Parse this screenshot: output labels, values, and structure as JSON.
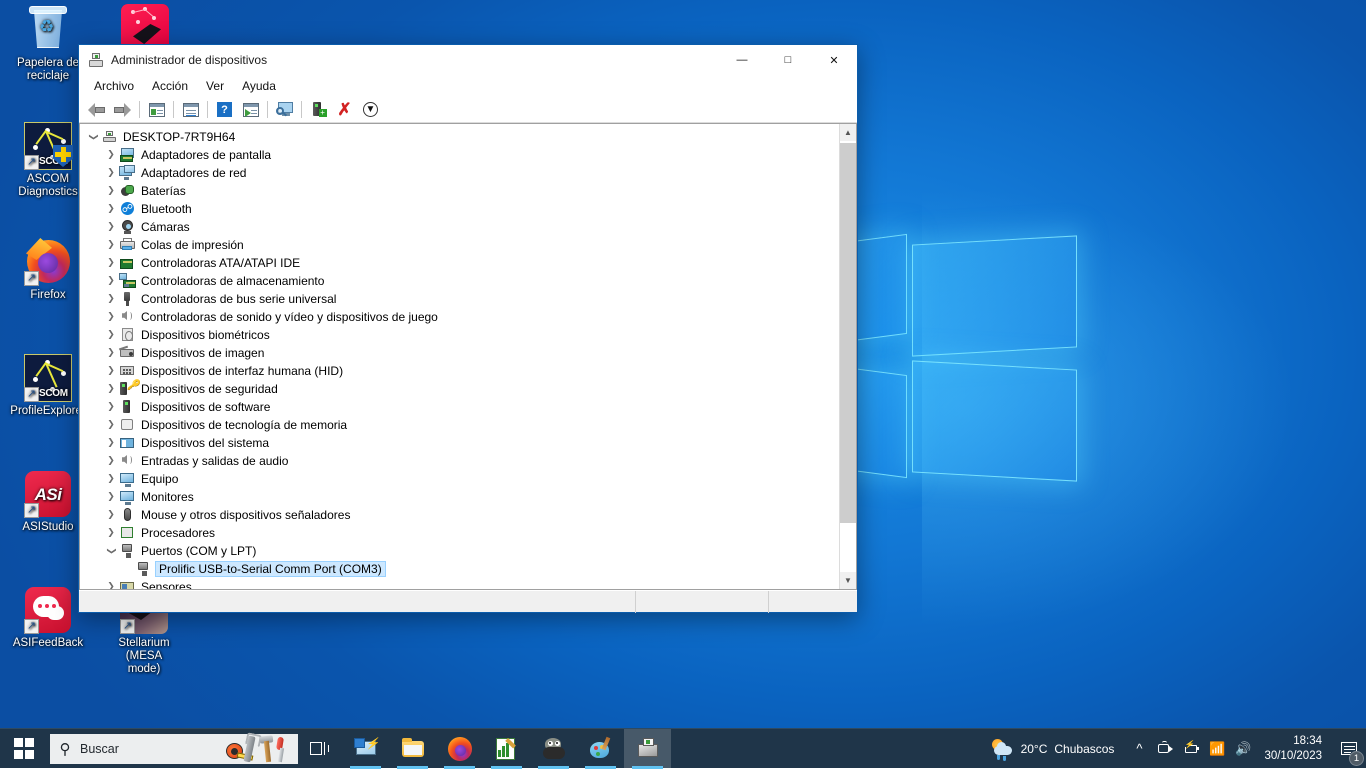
{
  "desktop": {
    "icons": [
      {
        "name": "recycle-bin",
        "label": "Papelera de\nreciclaje",
        "label_line1": "Papelera de",
        "label_line2": "reciclaje"
      },
      {
        "name": "stellarium-top",
        "label": ""
      },
      {
        "name": "ascom-diagnostics",
        "label_line1": "ASCOM",
        "label_line2": "Diagnostics",
        "badge": "SCOM"
      },
      {
        "name": "firefox",
        "label_line1": "Firefox",
        "label_line2": ""
      },
      {
        "name": "ascom-profile-explorer",
        "label_line1": "ProfileExplorer",
        "label_line2": "",
        "badge": "SCOM"
      },
      {
        "name": "asistudio",
        "label_line1": "ASIStudio",
        "label_line2": "",
        "badge": "ASi"
      },
      {
        "name": "asifeedback",
        "label_line1": "ASIFeedBack",
        "label_line2": ""
      },
      {
        "name": "stellarium-mesa",
        "label_line1": "Stellarium (MESA",
        "label_line2": "mode)"
      }
    ]
  },
  "window": {
    "title": "Administrador de dispositivos",
    "icon": "device-manager-icon",
    "controls": {
      "minimize": "—",
      "maximize": "□",
      "close": "✕"
    },
    "menu": [
      "Archivo",
      "Acción",
      "Ver",
      "Ayuda"
    ],
    "toolbar": [
      {
        "name": "back-button",
        "icon": "back-arrow-icon"
      },
      {
        "name": "forward-button",
        "icon": "forward-arrow-icon"
      },
      {
        "name": "show-hidden-button",
        "icon": "window-list-icon"
      },
      {
        "name": "properties-button",
        "icon": "properties-icon"
      },
      {
        "name": "help-button",
        "icon": "help-icon"
      },
      {
        "name": "update-driver-button",
        "icon": "window-play-icon"
      },
      {
        "name": "scan-hardware-button",
        "icon": "scan-monitor-icon"
      },
      {
        "name": "add-legacy-hardware-button",
        "icon": "driver-add-icon"
      },
      {
        "name": "uninstall-device-button",
        "icon": "red-x-icon"
      },
      {
        "name": "disable-device-button",
        "icon": "down-arrow-circle-icon"
      }
    ],
    "statusbar": {
      "pane1": "",
      "pane2": "",
      "pane3": ""
    }
  },
  "tree": {
    "root": {
      "label": "DESKTOP-7RT9H64",
      "icon": "computer-icon",
      "expanded": true
    },
    "nodes": [
      {
        "label": "Adaptadores de pantalla",
        "icon": "display-adapter-icon",
        "expanded": false
      },
      {
        "label": "Adaptadores de red",
        "icon": "network-adapter-icon",
        "expanded": false
      },
      {
        "label": "Baterías",
        "icon": "battery-icon",
        "expanded": false
      },
      {
        "label": "Bluetooth",
        "icon": "bluetooth-icon",
        "expanded": false
      },
      {
        "label": "Cámaras",
        "icon": "camera-icon",
        "expanded": false
      },
      {
        "label": "Colas de impresión",
        "icon": "printer-icon",
        "expanded": false
      },
      {
        "label": "Controladoras ATA/ATAPI IDE",
        "icon": "ata-controller-icon",
        "expanded": false
      },
      {
        "label": "Controladoras de almacenamiento",
        "icon": "storage-controller-icon",
        "expanded": false
      },
      {
        "label": "Controladoras de bus serie universal",
        "icon": "usb-icon",
        "expanded": false
      },
      {
        "label": "Controladoras de sonido y vídeo y dispositivos de juego",
        "icon": "speaker-icon",
        "expanded": false
      },
      {
        "label": "Dispositivos biométricos",
        "icon": "fingerprint-icon",
        "expanded": false
      },
      {
        "label": "Dispositivos de imagen",
        "icon": "imaging-device-icon",
        "expanded": false
      },
      {
        "label": "Dispositivos de interfaz humana (HID)",
        "icon": "hid-icon",
        "expanded": false
      },
      {
        "label": "Dispositivos de seguridad",
        "icon": "security-device-icon",
        "expanded": false
      },
      {
        "label": "Dispositivos de software",
        "icon": "software-device-icon",
        "expanded": false
      },
      {
        "label": "Dispositivos de tecnología de memoria",
        "icon": "memory-device-icon",
        "expanded": false
      },
      {
        "label": "Dispositivos del sistema",
        "icon": "system-device-icon",
        "expanded": false
      },
      {
        "label": "Entradas y salidas de audio",
        "icon": "audio-io-icon",
        "expanded": false
      },
      {
        "label": "Equipo",
        "icon": "computer-device-icon",
        "expanded": false
      },
      {
        "label": "Monitores",
        "icon": "monitor-icon",
        "expanded": false
      },
      {
        "label": "Mouse y otros dispositivos señaladores",
        "icon": "mouse-icon",
        "expanded": false
      },
      {
        "label": "Procesadores",
        "icon": "processor-icon",
        "expanded": false
      },
      {
        "label": "Puertos (COM y LPT)",
        "icon": "port-icon",
        "expanded": true
      },
      {
        "label": "Sensores",
        "icon": "sensor-icon",
        "expanded": false
      }
    ],
    "selected_child": {
      "label": "Prolific USB-to-Serial Comm Port (COM3)",
      "icon": "port-icon",
      "parent": "Puertos (COM y LPT)"
    },
    "selection_color": "#cde8ff"
  },
  "taskbar": {
    "start": {
      "name": "start-button",
      "icon": "windows-logo-icon"
    },
    "search": {
      "placeholder": "Buscar",
      "icon": "search-icon",
      "art": "tools-illustration"
    },
    "taskview": {
      "name": "task-view-button",
      "icon": "task-view-icon"
    },
    "apps": [
      {
        "name": "remote-desktop",
        "icon": "remote-desktop-icon",
        "active": false,
        "running": true
      },
      {
        "name": "file-explorer",
        "icon": "folder-icon",
        "active": false,
        "running": true
      },
      {
        "name": "firefox",
        "icon": "firefox-icon",
        "active": false,
        "running": true
      },
      {
        "name": "notepad-chart-app",
        "icon": "notepad-edit-icon",
        "active": false,
        "running": true
      },
      {
        "name": "gimp",
        "icon": "gimp-wilber-icon",
        "active": false,
        "running": true
      },
      {
        "name": "paint",
        "icon": "paint-palette-icon",
        "active": false,
        "running": true
      },
      {
        "name": "device-manager",
        "icon": "device-manager-icon",
        "active": true,
        "running": true
      }
    ],
    "tray": {
      "weather": {
        "temperature": "20°C",
        "condition": "Chubascos",
        "icon": "sun-rain-icon"
      },
      "icons": [
        {
          "name": "show-hidden-icons",
          "glyph": "∧"
        },
        {
          "name": "camera-privacy-icon",
          "glyph": "camera"
        },
        {
          "name": "battery-icon",
          "glyph": "battery"
        },
        {
          "name": "wifi-icon",
          "glyph": "wifi"
        },
        {
          "name": "volume-icon",
          "glyph": "speaker"
        }
      ],
      "clock": {
        "time": "18:34",
        "date": "30/10/2023"
      },
      "notifications": {
        "icon": "notification-icon",
        "badge": "1"
      }
    }
  },
  "colors": {
    "accent": "#0078d7",
    "taskbar_bg": "#1f3549",
    "selection": "#cde8ff",
    "desktop_blue": "#0a63c0"
  }
}
